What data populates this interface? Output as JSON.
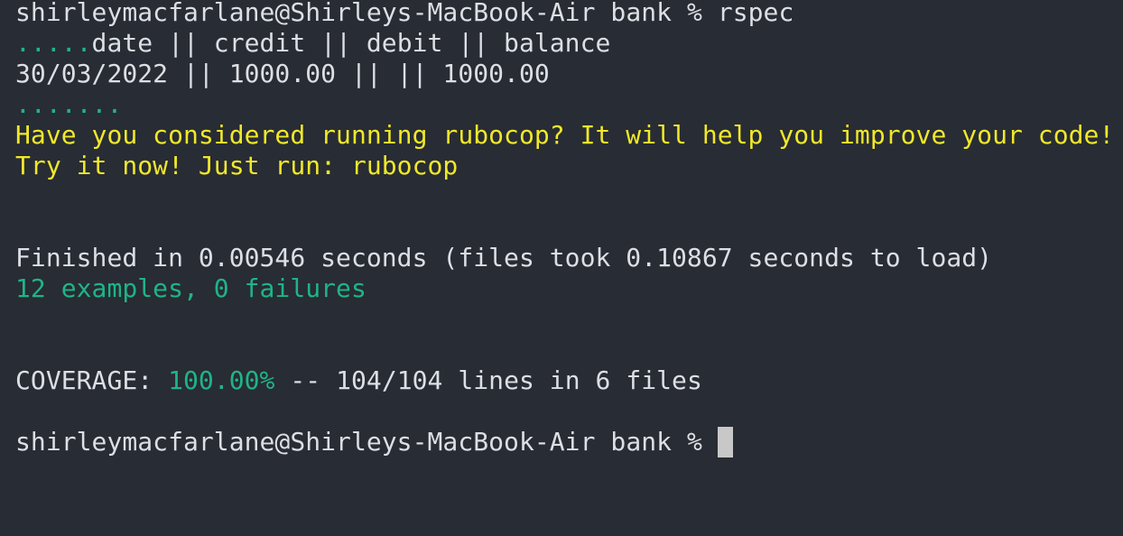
{
  "terminal": {
    "prompt_user_host": "shirleymacfarlane@Shirleys-MacBook-Air",
    "prompt_dir": "bank",
    "prompt_symbol": "%",
    "command": "rspec",
    "progress_dots_1": ".....",
    "table_header": "date || credit || debit || balance",
    "table_row": "30/03/2022 || 1000.00 || || 1000.00",
    "progress_dots_2": ".......",
    "rubocop_hint_1": "Have you considered running rubocop? It will help you improve your code!",
    "rubocop_hint_2": "Try it now! Just run: rubocop",
    "finished_line": "Finished in 0.00546 seconds (files took 0.10867 seconds to load)",
    "summary_line": "12 examples, 0 failures",
    "coverage_label": "COVERAGE:",
    "coverage_percent": "100.00%",
    "coverage_detail": "-- 104/104 lines in 6 files",
    "colors": {
      "background": "#282c34",
      "foreground": "#dcdfe4",
      "success_green": "#1fb488",
      "warning_yellow": "#f0e82a",
      "cursor": "#c8c8c8"
    }
  }
}
